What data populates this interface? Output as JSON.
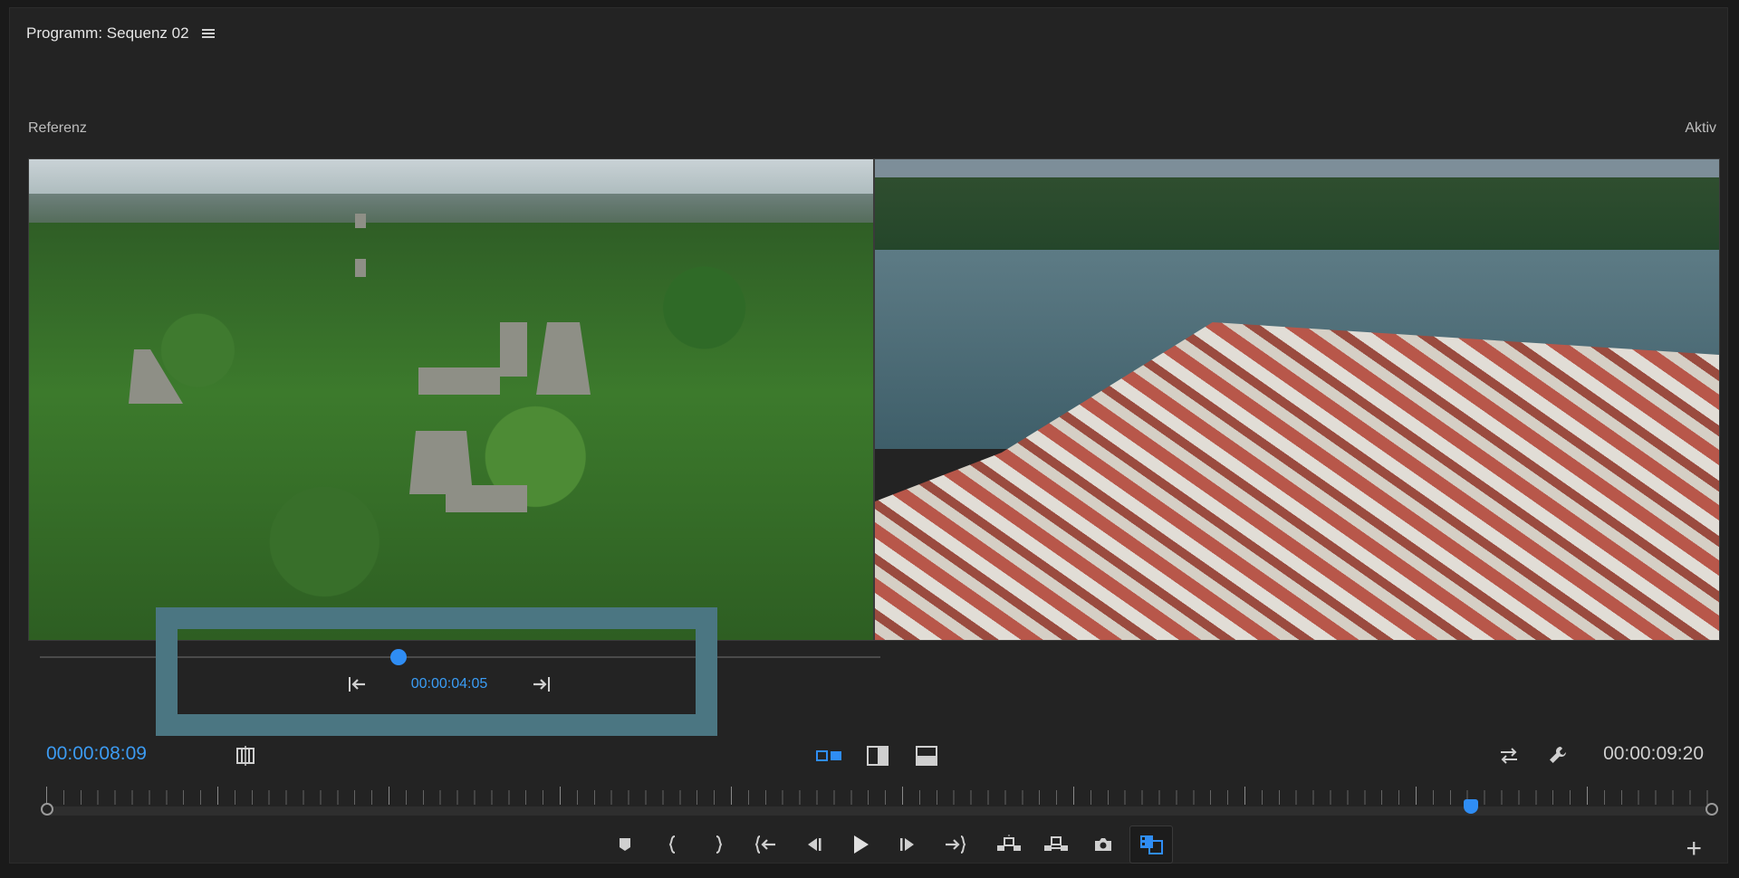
{
  "header": {
    "title": "Programm: Sequenz 02",
    "menu_icon": "hamburger-menu-icon"
  },
  "monitors": {
    "reference_label": "Referenz",
    "active_label": "Aktiv"
  },
  "trim": {
    "timecode": "00:00:04:05"
  },
  "footer": {
    "current_timecode": "00:00:08:09",
    "duration_timecode": "00:00:09:20"
  },
  "transport": {
    "buttons": [
      "add-marker-icon",
      "mark-in-icon",
      "mark-out-icon",
      "go-to-in-icon",
      "step-back-icon",
      "play-icon",
      "step-forward-icon",
      "go-to-out-icon",
      "lift-icon",
      "extract-icon",
      "export-frame-icon",
      "comparison-view-icon"
    ]
  },
  "colors": {
    "accent": "#2f8df4",
    "highlight": "#4b7682",
    "background": "#232323"
  }
}
